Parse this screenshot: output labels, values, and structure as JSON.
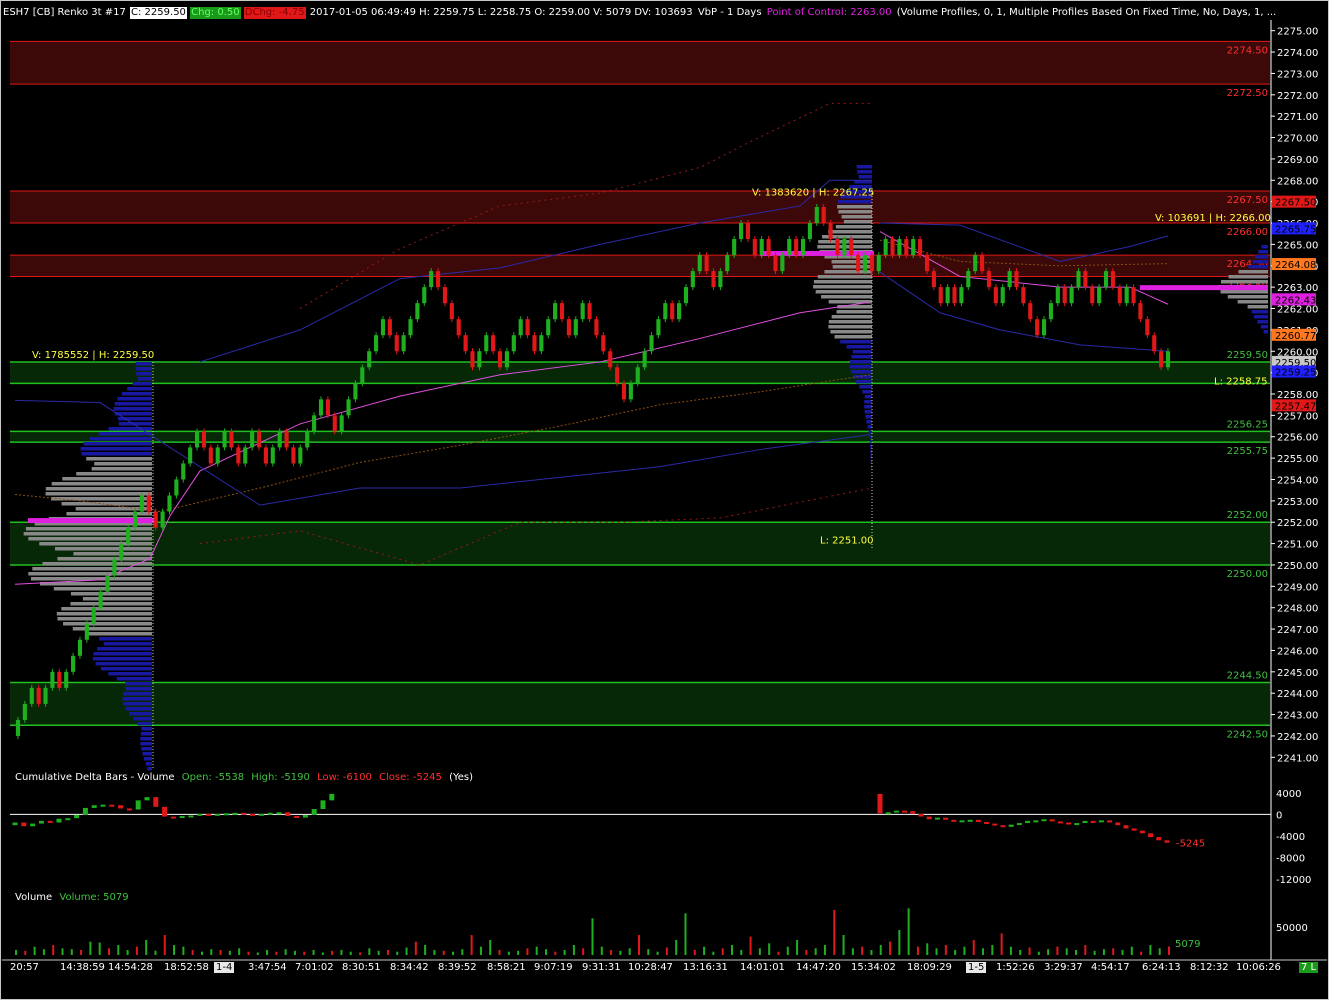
{
  "header": {
    "symbol": "ESH7 [CB]  Renko 3t  #17",
    "last": "C: 2259.50",
    "chg": "Chg: 0.50",
    "dchg": "DChg: -4.75",
    "bar_info": "2017-01-05 06:49:49 H: 2259.75  L: 2258.75  O: 2259.00  V: 5079  DV: 103693",
    "study_name": "VbP - 1 Days",
    "poc": "Point of Control: 2263.00",
    "study_params": "(Volume Profiles, 0, 1, Multiple Profiles Based On Fixed Time, No, Days, 1, ..."
  },
  "colors": {
    "up": "#1eb01e",
    "down": "#e01818",
    "resistance_zone": "#3c0808",
    "support_zone": "#062806",
    "profile": "#1818a0",
    "poc": "#e020e0",
    "value_area_gray": "#888888",
    "band_blue": "#2a2aa8",
    "band_brown": "#8a5010",
    "band_dotred": "#9a1818",
    "text_yellow": "#ffff40",
    "text_red": "#ff3030",
    "text_green": "#40c040"
  },
  "price_axis": {
    "ticks": [
      "2275.00",
      "2274.00",
      "2273.00",
      "2272.00",
      "2271.00",
      "2270.00",
      "2269.00",
      "2268.00",
      "2267.00",
      "2266.00",
      "2265.00",
      "2264.00",
      "2263.00",
      "2262.00",
      "2261.00",
      "2260.00",
      "2259.00",
      "2258.00",
      "2257.00",
      "2256.00",
      "2255.00",
      "2254.00",
      "2253.00",
      "2252.00",
      "2251.00",
      "2250.00",
      "2249.00",
      "2248.00",
      "2247.00",
      "2246.00",
      "2245.00",
      "2244.00",
      "2243.00",
      "2242.00",
      "2241.00"
    ],
    "price_tags": [
      {
        "label": "2267.50",
        "bg": "#e01818",
        "fg": "#000000",
        "price": 2267.0
      },
      {
        "label": "2265.75",
        "bg": "#2020ff",
        "fg": "#000000",
        "price": 2265.75
      },
      {
        "label": "2264.08",
        "bg": "#ff7820",
        "fg": "#000000",
        "price": 2264.08
      },
      {
        "label": "2262.43",
        "bg": "#e020e0",
        "fg": "#000000",
        "price": 2262.43
      },
      {
        "label": "2260.77",
        "bg": "#ff7820",
        "fg": "#000000",
        "price": 2260.77
      },
      {
        "label": "2259.50",
        "bg": "#c8c8c8",
        "fg": "#000000",
        "price": 2259.5
      },
      {
        "label": "2259.25",
        "bg": "#2020ff",
        "fg": "#000000",
        "price": 2259.05
      },
      {
        "label": "2257.47",
        "bg": "#e01818",
        "fg": "#000000",
        "price": 2257.47
      }
    ]
  },
  "levels": {
    "resistance": [
      {
        "label": "2274.50",
        "top": 2274.5,
        "bottom": 2272.5
      },
      {
        "label": "2272.50",
        "top": null,
        "bottom": null
      },
      {
        "label": "2267.50",
        "top": 2267.5,
        "bottom": 2266.0
      },
      {
        "label": "2266.00",
        "top": null,
        "bottom": null
      },
      {
        "label": "2264.50",
        "top": 2264.5,
        "bottom": 2263.5
      },
      {
        "label": "2263.50",
        "top": null,
        "bottom": null
      }
    ],
    "support": [
      {
        "label": "2259.50",
        "top": 2259.5,
        "bottom": 2258.5
      },
      {
        "label": "2256.25",
        "top": 2256.25,
        "bottom": 2255.75
      },
      {
        "label": "2255.75",
        "top": null,
        "bottom": null
      },
      {
        "label": "2252.00",
        "top": 2252.0,
        "bottom": 2250.0
      },
      {
        "label": "2250.00",
        "top": null,
        "bottom": null
      },
      {
        "label": "2244.50",
        "top": 2244.5,
        "bottom": 2242.5
      },
      {
        "label": "2242.50",
        "top": null,
        "bottom": null
      }
    ]
  },
  "annotations": [
    {
      "text": "V: 1785552 | H: 2259.50",
      "price": 2259.6,
      "color": "#ffff40"
    },
    {
      "text": "V: 1383620 | H: 2267.25",
      "price": 2267.2,
      "color": "#ffff40"
    },
    {
      "text": "V: 103691 | H: 2266.00",
      "price": 2266.0,
      "color": "#ffff40"
    },
    {
      "text": "L: 2251.00",
      "price": 2250.9,
      "color": "#ffff40"
    },
    {
      "text": "L: 2258.75",
      "price": 2258.35,
      "color": "#ffff40"
    }
  ],
  "delta_panel": {
    "title": "Cumulative Delta Bars - Volume",
    "open": "Open: -5538",
    "high": "High: -5190",
    "low": "Low: -6100",
    "close": "Close: -5245",
    "yes": "(Yes)",
    "ticks": [
      "4000",
      "0",
      "-4000",
      "-8000",
      "-12000"
    ],
    "last_value": "-5245"
  },
  "volume_panel": {
    "title": "Volume",
    "value": "Volume: 5079",
    "ticks": [
      "50000"
    ],
    "last_value": "5079"
  },
  "time_axis": {
    "labels": [
      "20:57",
      "14:38:59",
      "14:54:28",
      "18:52:58",
      "1-4",
      "3:47:54",
      "7:01:02",
      "8:30:51",
      "8:34:42",
      "8:39:52",
      "8:58:21",
      "9:07:19",
      "9:31:31",
      "10:28:47",
      "13:16:31",
      "14:01:01",
      "14:47:20",
      "15:34:02",
      "18:09:29",
      "1-5",
      "1:52:26",
      "3:29:37",
      "4:54:17",
      "6:24:13",
      "8:12:32",
      "10:06:26",
      "7 L"
    ]
  },
  "chart_data": {
    "type": "candlestick",
    "title": "ESH7 [CB] Renko 3t #17",
    "ylim": [
      2240.5,
      2275.5
    ],
    "brick_size": 0.75,
    "closes": [
      2242.75,
      2243.5,
      2244.25,
      2243.5,
      2244.25,
      2245,
      2244.25,
      2245,
      2245.75,
      2246.5,
      2247.25,
      2248,
      2248.75,
      2249.5,
      2250.25,
      2251,
      2251.75,
      2252.5,
      2253.25,
      2252.5,
      2251.75,
      2252.5,
      2253.25,
      2254,
      2254.75,
      2255.5,
      2256.25,
      2255.5,
      2254.75,
      2255.5,
      2256.25,
      2255.5,
      2254.75,
      2255.5,
      2256.25,
      2255.5,
      2254.75,
      2255.5,
      2256.25,
      2255.5,
      2254.75,
      2255.5,
      2256.25,
      2257,
      2257.75,
      2257,
      2256.25,
      2257,
      2257.75,
      2258.5,
      2259.25,
      2260,
      2260.75,
      2261.5,
      2260.75,
      2260,
      2260.75,
      2261.5,
      2262.25,
      2263,
      2263.75,
      2263,
      2262.25,
      2261.5,
      2260.75,
      2260,
      2259.25,
      2260,
      2260.75,
      2260,
      2259.25,
      2260,
      2260.75,
      2261.5,
      2260.75,
      2260,
      2260.75,
      2261.5,
      2262.25,
      2261.5,
      2260.75,
      2261.5,
      2262.25,
      2261.5,
      2260.75,
      2260,
      2259.25,
      2258.5,
      2257.75,
      2258.5,
      2259.25,
      2260,
      2260.75,
      2261.5,
      2262.25,
      2261.5,
      2262.25,
      2263,
      2263.75,
      2264.5,
      2263.75,
      2263,
      2263.75,
      2264.5,
      2265.25,
      2266,
      2265.25,
      2264.5,
      2265.25,
      2264.5,
      2263.75,
      2264.5,
      2265.25,
      2264.5,
      2265.25,
      2266,
      2266.75,
      2266,
      2265.25,
      2264.5,
      2265.25,
      2264.5,
      2263.75,
      2264.5,
      2263.75,
      2264.5,
      2265.25,
      2264.5,
      2265.25,
      2264.5,
      2265.25,
      2264.5,
      2263.75,
      2263,
      2262.25,
      2263,
      2262.25,
      2263,
      2263.75,
      2264.5,
      2263.75,
      2263,
      2262.25,
      2263,
      2263.75,
      2263,
      2262.25,
      2261.5,
      2260.75,
      2261.5,
      2262.25,
      2263,
      2262.25,
      2263,
      2263.75,
      2263,
      2262.25,
      2263,
      2263.75,
      2263,
      2262.25,
      2263,
      2262.25,
      2261.5,
      2260.75,
      2260,
      2259.25,
      2260
    ],
    "delta_closes": [
      -1500,
      -2200,
      -1700,
      -1200,
      -1500,
      -800,
      -700,
      -100,
      1200,
      1700,
      1800,
      1700,
      1100,
      900,
      2600,
      3200,
      1400,
      -400,
      -600,
      -300,
      -200,
      100,
      -200,
      100,
      200,
      300,
      100,
      -100,
      100,
      300,
      400,
      -300,
      -600,
      -100,
      1000,
      2600,
      3800,
      200,
      400,
      700,
      600,
      100,
      -400,
      -900,
      -600,
      -1000,
      -1300,
      -1100,
      -1000,
      -1400,
      -1700,
      -2000,
      -2300,
      -1900,
      -1600,
      -1200,
      -1100,
      -900,
      -1300,
      -1500,
      -1800,
      -1600,
      -1200,
      -1400,
      -1100,
      -1500,
      -2000,
      -2600,
      -3000,
      -3500,
      -4200,
      -4800,
      -5245
    ],
    "volumes": [
      3000,
      2500,
      5000,
      3500,
      6000,
      4000,
      3500,
      3000,
      8000,
      7500,
      4000,
      6000,
      3000,
      5000,
      9000,
      2600,
      12000,
      6000,
      5000,
      3000,
      2000,
      3500,
      3000,
      2500,
      4000,
      2000,
      1500,
      3000,
      2000,
      3500,
      2500,
      2000,
      3000,
      1500,
      2500,
      3000,
      2000,
      1500,
      4000,
      2500,
      3000,
      2000,
      4500,
      8000,
      6000,
      3000,
      2500,
      2000,
      3500,
      12000,
      5000,
      9000,
      3000,
      2000,
      2500,
      4000,
      5000,
      3500,
      2000,
      3000,
      6000,
      4000,
      22000,
      5000,
      3000,
      2500,
      4000,
      12000,
      3500,
      2000,
      4500,
      9000,
      25000,
      3000,
      5000,
      2000,
      4000,
      6000,
      3000,
      11000,
      4000,
      7000,
      2000,
      5000,
      9000,
      3000,
      4000,
      6000,
      27000,
      12000,
      4000,
      5000,
      3000,
      6000,
      8000,
      15000,
      28000,
      5000,
      7000,
      4000,
      6000,
      3000,
      5000,
      9000,
      4000,
      6000,
      13000,
      5000,
      3000,
      4500,
      2000,
      3500,
      5000,
      4000,
      3000,
      6000,
      2500,
      3500,
      4000,
      3000,
      5000,
      2000,
      6000,
      4000,
      5079
    ]
  }
}
